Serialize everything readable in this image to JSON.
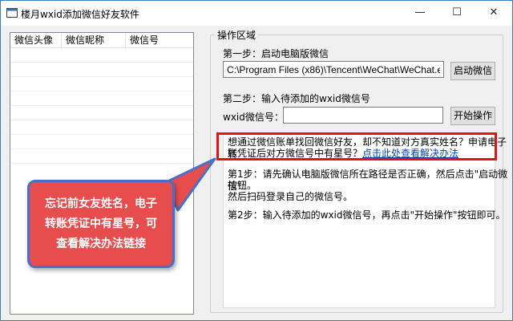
{
  "window": {
    "title": "楼月wxid添加微信好友软件",
    "minimize": "—",
    "maximize": "☐",
    "close": "✕"
  },
  "list": {
    "columns": [
      "微信头像",
      "微信昵称",
      "微信号"
    ]
  },
  "group": {
    "label": "操作区域",
    "step1_label": "第一步：启动电脑版微信",
    "path_value": "C:\\Program Files (x86)\\Tencent\\WeChat\\WeChat.exe",
    "start_wechat_button": "启动微信",
    "step2_label": "第二步：输入待添加的wxid微信号",
    "wxid_label": "wxid微信号：",
    "wxid_value": "",
    "start_op_button": "开始操作"
  },
  "instructions": {
    "promo_line1": "想通过微信账单找回微信好友，却不知道对方真实姓名？申请电子转",
    "promo_line2": "账凭证后对方微信号中有星号？",
    "promo_link": "点击此处查看解决办法",
    "step1_line1": "第1步：请先确认电脑版微信所在路径是否正确，然后点击\"启动微信\"",
    "step1_line2": "按钮。",
    "step1_line3": "然后扫码登录自己的微信号。",
    "step2_line": "第2步：输入待添加的wxid微信号，再点击\"开始操作\"按钮即可。"
  },
  "callout": {
    "line1": "忘记前女友姓名，电子",
    "line2": "转账凭证中有星号，可",
    "line3": "查看解决办法链接"
  },
  "colors": {
    "highlight_border": "#e01414",
    "callout_fill": "#e84d4d",
    "callout_border": "#4a6fc7",
    "link": "#0645ad"
  }
}
